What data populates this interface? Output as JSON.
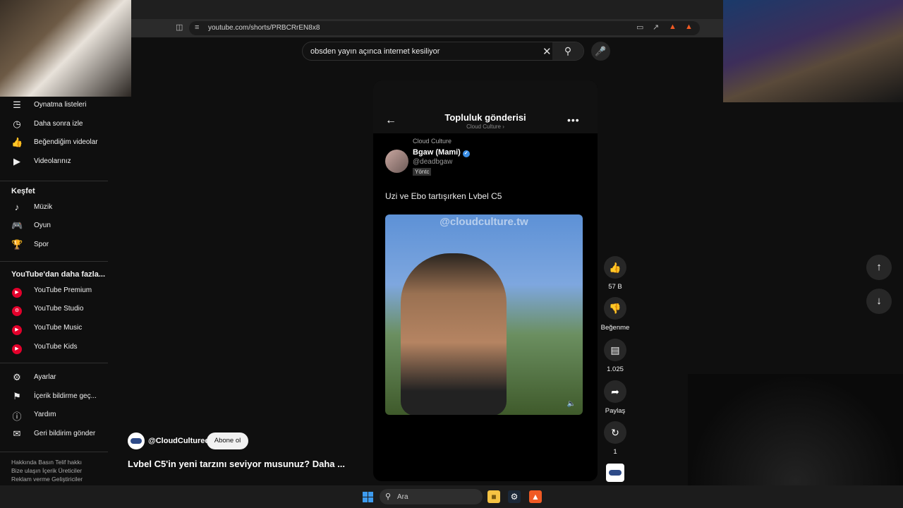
{
  "browser": {
    "url": "youtube.com/shorts/PRBCRrEN8x8",
    "bookmark_icon": "bookmark-icon"
  },
  "search": {
    "query": "obsden yayın açınca internet kesiliyor",
    "clear_icon": "close-icon",
    "search_icon": "search-icon",
    "mic_icon": "mic-icon"
  },
  "sidebar": {
    "you_items": [
      {
        "label": "Oynatma listeleri",
        "icon": "playlist-icon"
      },
      {
        "label": "Daha sonra izle",
        "icon": "clock-icon"
      },
      {
        "label": "Beğendiğim videolar",
        "icon": "thumbs-up-icon"
      },
      {
        "label": "Videolarınız",
        "icon": "video-icon"
      }
    ],
    "explore_heading": "Keşfet",
    "explore_items": [
      {
        "label": "Müzik",
        "icon": "music-icon"
      },
      {
        "label": "Oyun",
        "icon": "gamepad-icon"
      },
      {
        "label": "Spor",
        "icon": "trophy-icon"
      }
    ],
    "more_heading": "YouTube'dan daha fazla...",
    "more_items": [
      {
        "label": "YouTube Premium",
        "icon": "youtube-icon"
      },
      {
        "label": "YouTube Studio",
        "icon": "youtube-studio-icon"
      },
      {
        "label": "YouTube Music",
        "icon": "youtube-music-icon"
      },
      {
        "label": "YouTube Kids",
        "icon": "youtube-kids-icon"
      }
    ],
    "settings_items": [
      {
        "label": "Ayarlar",
        "icon": "gear-icon"
      },
      {
        "label": "İçerik bildirme geç...",
        "icon": "flag-icon"
      },
      {
        "label": "Yardım",
        "icon": "help-icon"
      },
      {
        "label": "Geri bildirim gönder",
        "icon": "feedback-icon"
      }
    ],
    "footer_line1": "Hakkında   Basın   Telif hakkı",
    "footer_line2": "Bize ulaşın   İçerik Üreticiler",
    "footer_line3": "Reklam verme   Geliştiriciler"
  },
  "post": {
    "header_title": "Topluluk gönderisi",
    "header_sub": "Cloud Culture ›",
    "channel_small": "Cloud Culture",
    "author": "Bgaw (Mami)",
    "handle": "@deadbgaw",
    "tag": "Yöntc",
    "text": "Uzi ve Ebo tartışırken Lvbel C5",
    "watermark": "@cloudculture.tw"
  },
  "actions": {
    "like_count": "57 B",
    "dislike_label": "Beğenme",
    "comment_count": "1.025",
    "share_label": "Paylaş",
    "remix_count": "1"
  },
  "video_meta": {
    "channel": "@CloudCulturee",
    "subscribe_label": "Abone ol",
    "title": "Lvbel C5'in yeni tarzını seviyor musunuz? Daha ..."
  },
  "taskbar": {
    "search_placeholder": "Ara"
  },
  "colors": {
    "background": "#0f0f0f",
    "youtube_red": "#e3002b",
    "verified_blue": "#3a8ee6"
  }
}
